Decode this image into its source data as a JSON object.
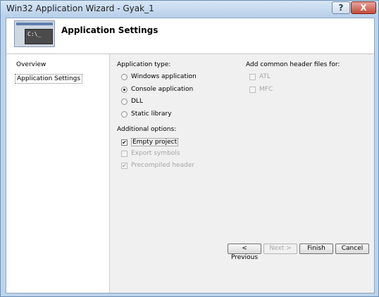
{
  "window": {
    "title": "Win32 Application Wizard - Gyak_1",
    "help_label": "?",
    "close_label": "X"
  },
  "banner": {
    "title": "Application Settings",
    "image_text": "C:\\_"
  },
  "nav": {
    "items": [
      {
        "label": "Overview"
      },
      {
        "label": "Application Settings",
        "selected": true
      }
    ]
  },
  "app_type": {
    "label": "Application type:",
    "options": [
      {
        "label": "Windows application",
        "checked": false
      },
      {
        "label": "Console application",
        "checked": true
      },
      {
        "label": "DLL",
        "checked": false
      },
      {
        "label": "Static library",
        "checked": false
      }
    ]
  },
  "additional": {
    "label": "Additional options:",
    "options": [
      {
        "label": "Empty project",
        "checked": true,
        "enabled": true
      },
      {
        "label": "Export symbols",
        "checked": false,
        "enabled": false
      },
      {
        "label": "Precompiled header",
        "checked": true,
        "enabled": false
      }
    ]
  },
  "headers": {
    "label": "Add common header files for:",
    "options": [
      {
        "label": "ATL",
        "checked": false,
        "enabled": false
      },
      {
        "label": "MFC",
        "checked": false,
        "enabled": false
      }
    ]
  },
  "buttons": {
    "previous": "< Previous",
    "next": "Next >",
    "finish": "Finish",
    "cancel": "Cancel"
  }
}
